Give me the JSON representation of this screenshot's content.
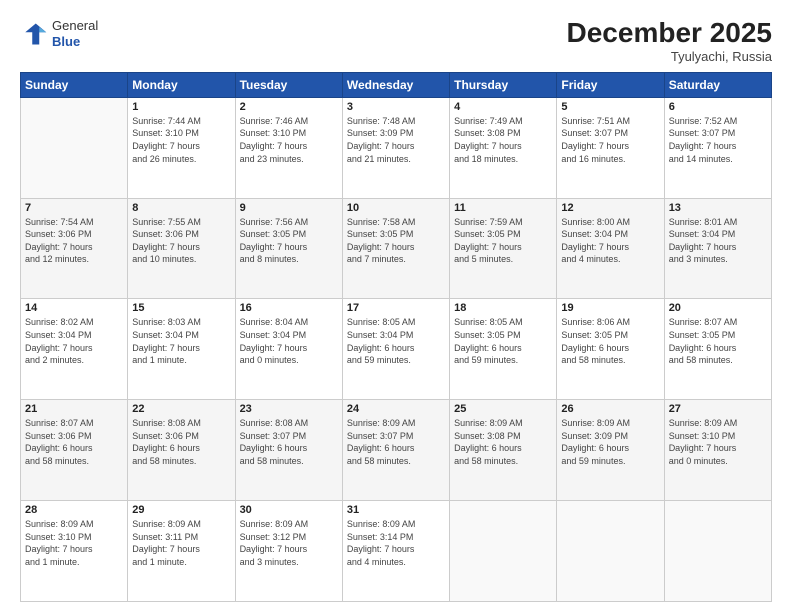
{
  "logo": {
    "general": "General",
    "blue": "Blue"
  },
  "header": {
    "month_year": "December 2025",
    "location": "Tyulyachi, Russia"
  },
  "weekdays": [
    "Sunday",
    "Monday",
    "Tuesday",
    "Wednesday",
    "Thursday",
    "Friday",
    "Saturday"
  ],
  "weeks": [
    [
      {
        "day": "",
        "info": ""
      },
      {
        "day": "1",
        "info": "Sunrise: 7:44 AM\nSunset: 3:10 PM\nDaylight: 7 hours\nand 26 minutes."
      },
      {
        "day": "2",
        "info": "Sunrise: 7:46 AM\nSunset: 3:10 PM\nDaylight: 7 hours\nand 23 minutes."
      },
      {
        "day": "3",
        "info": "Sunrise: 7:48 AM\nSunset: 3:09 PM\nDaylight: 7 hours\nand 21 minutes."
      },
      {
        "day": "4",
        "info": "Sunrise: 7:49 AM\nSunset: 3:08 PM\nDaylight: 7 hours\nand 18 minutes."
      },
      {
        "day": "5",
        "info": "Sunrise: 7:51 AM\nSunset: 3:07 PM\nDaylight: 7 hours\nand 16 minutes."
      },
      {
        "day": "6",
        "info": "Sunrise: 7:52 AM\nSunset: 3:07 PM\nDaylight: 7 hours\nand 14 minutes."
      }
    ],
    [
      {
        "day": "7",
        "info": "Sunrise: 7:54 AM\nSunset: 3:06 PM\nDaylight: 7 hours\nand 12 minutes."
      },
      {
        "day": "8",
        "info": "Sunrise: 7:55 AM\nSunset: 3:06 PM\nDaylight: 7 hours\nand 10 minutes."
      },
      {
        "day": "9",
        "info": "Sunrise: 7:56 AM\nSunset: 3:05 PM\nDaylight: 7 hours\nand 8 minutes."
      },
      {
        "day": "10",
        "info": "Sunrise: 7:58 AM\nSunset: 3:05 PM\nDaylight: 7 hours\nand 7 minutes."
      },
      {
        "day": "11",
        "info": "Sunrise: 7:59 AM\nSunset: 3:05 PM\nDaylight: 7 hours\nand 5 minutes."
      },
      {
        "day": "12",
        "info": "Sunrise: 8:00 AM\nSunset: 3:04 PM\nDaylight: 7 hours\nand 4 minutes."
      },
      {
        "day": "13",
        "info": "Sunrise: 8:01 AM\nSunset: 3:04 PM\nDaylight: 7 hours\nand 3 minutes."
      }
    ],
    [
      {
        "day": "14",
        "info": "Sunrise: 8:02 AM\nSunset: 3:04 PM\nDaylight: 7 hours\nand 2 minutes."
      },
      {
        "day": "15",
        "info": "Sunrise: 8:03 AM\nSunset: 3:04 PM\nDaylight: 7 hours\nand 1 minute."
      },
      {
        "day": "16",
        "info": "Sunrise: 8:04 AM\nSunset: 3:04 PM\nDaylight: 7 hours\nand 0 minutes."
      },
      {
        "day": "17",
        "info": "Sunrise: 8:05 AM\nSunset: 3:04 PM\nDaylight: 6 hours\nand 59 minutes."
      },
      {
        "day": "18",
        "info": "Sunrise: 8:05 AM\nSunset: 3:05 PM\nDaylight: 6 hours\nand 59 minutes."
      },
      {
        "day": "19",
        "info": "Sunrise: 8:06 AM\nSunset: 3:05 PM\nDaylight: 6 hours\nand 58 minutes."
      },
      {
        "day": "20",
        "info": "Sunrise: 8:07 AM\nSunset: 3:05 PM\nDaylight: 6 hours\nand 58 minutes."
      }
    ],
    [
      {
        "day": "21",
        "info": "Sunrise: 8:07 AM\nSunset: 3:06 PM\nDaylight: 6 hours\nand 58 minutes."
      },
      {
        "day": "22",
        "info": "Sunrise: 8:08 AM\nSunset: 3:06 PM\nDaylight: 6 hours\nand 58 minutes."
      },
      {
        "day": "23",
        "info": "Sunrise: 8:08 AM\nSunset: 3:07 PM\nDaylight: 6 hours\nand 58 minutes."
      },
      {
        "day": "24",
        "info": "Sunrise: 8:09 AM\nSunset: 3:07 PM\nDaylight: 6 hours\nand 58 minutes."
      },
      {
        "day": "25",
        "info": "Sunrise: 8:09 AM\nSunset: 3:08 PM\nDaylight: 6 hours\nand 58 minutes."
      },
      {
        "day": "26",
        "info": "Sunrise: 8:09 AM\nSunset: 3:09 PM\nDaylight: 6 hours\nand 59 minutes."
      },
      {
        "day": "27",
        "info": "Sunrise: 8:09 AM\nSunset: 3:10 PM\nDaylight: 7 hours\nand 0 minutes."
      }
    ],
    [
      {
        "day": "28",
        "info": "Sunrise: 8:09 AM\nSunset: 3:10 PM\nDaylight: 7 hours\nand 1 minute."
      },
      {
        "day": "29",
        "info": "Sunrise: 8:09 AM\nSunset: 3:11 PM\nDaylight: 7 hours\nand 1 minute."
      },
      {
        "day": "30",
        "info": "Sunrise: 8:09 AM\nSunset: 3:12 PM\nDaylight: 7 hours\nand 3 minutes."
      },
      {
        "day": "31",
        "info": "Sunrise: 8:09 AM\nSunset: 3:14 PM\nDaylight: 7 hours\nand 4 minutes."
      },
      {
        "day": "",
        "info": ""
      },
      {
        "day": "",
        "info": ""
      },
      {
        "day": "",
        "info": ""
      }
    ]
  ]
}
